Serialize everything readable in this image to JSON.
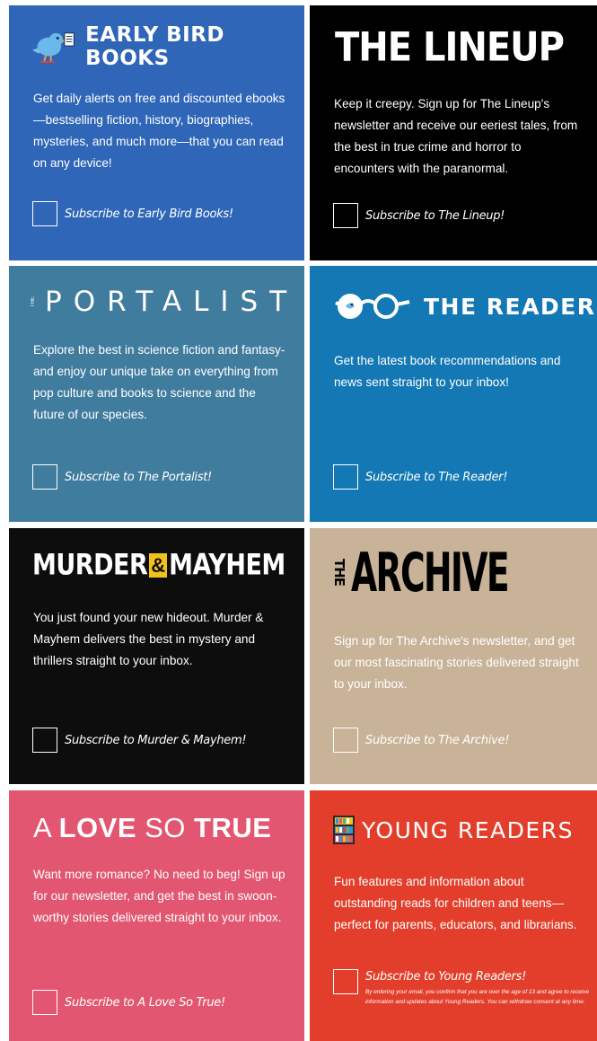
{
  "cards": [
    {
      "brand": "EARLY BIRD BOOKS",
      "description": "Get daily alerts on free and discounted ebooks—bestselling fiction, history, biographies, mysteries, and much more—that you can read on any device!",
      "subscribe_label": "Subscribe to Early Bird Books!",
      "icon": "bird-reading-icon",
      "background": "#2f66b8"
    },
    {
      "brand": "THE LINEUP",
      "description": "Keep it creepy. Sign up for The Lineup's newsletter and receive our eeriest tales, from the best in true crime and horror to encounters with the paranormal.",
      "subscribe_label": "Subscribe to The Lineup!",
      "background": "#000000"
    },
    {
      "brand_prefix": "THE",
      "brand": "PORTALIST",
      "description": "Explore the best in science fiction and fantasy-and enjoy our unique take on everything from pop culture and books to science and the future of our species.",
      "subscribe_label": "Subscribe to The Portalist!",
      "icon": "planet-icon",
      "background": "#407c9d"
    },
    {
      "brand": "THE READER",
      "description": "Get the latest book recommendations and news sent straight to your inbox!",
      "subscribe_label": "Subscribe to The Reader!",
      "icon": "glasses-icon",
      "background": "#1378b3"
    },
    {
      "brand_a": "MURDER",
      "brand_amp": "&",
      "brand_b": "MAYHEM",
      "description": "You just found your new hideout. Murder & Mayhem delivers the best in mystery and thrillers straight to your inbox.",
      "subscribe_label": "Subscribe to Murder & Mayhem!",
      "accent": "#f2c21c",
      "background": "#0d0d0d"
    },
    {
      "brand_prefix": "THE",
      "brand": "ARCHIVE",
      "description": "Sign up for The Archive's newsletter, and get our most fascinating stories delivered straight to your inbox.",
      "subscribe_label": "Subscribe to The Archive!",
      "background": "#c8b399"
    },
    {
      "brand_a": "A ",
      "brand_b": "LOVE",
      "brand_c": " SO ",
      "brand_d": "TRUE",
      "description": "Want more romance? No need to beg! Sign up for our newsletter, and get the best in swoon-worthy stories delivered straight to your inbox.",
      "subscribe_label": "Subscribe to A Love So True!",
      "background": "#e25671"
    },
    {
      "brand": "YOUNG READERS",
      "description": "Fun features and information about outstanding reads for children and teens—perfect for parents, educators, and librarians.",
      "subscribe_label": "Subscribe to Young Readers!",
      "disclaimer": "By entering your email, you confirm that you are over the age of 13 and agree to receive information and updates about Young Readers. You can withdraw consent at any time.",
      "icon": "bookshelf-icon",
      "background": "#e33e2b"
    }
  ]
}
